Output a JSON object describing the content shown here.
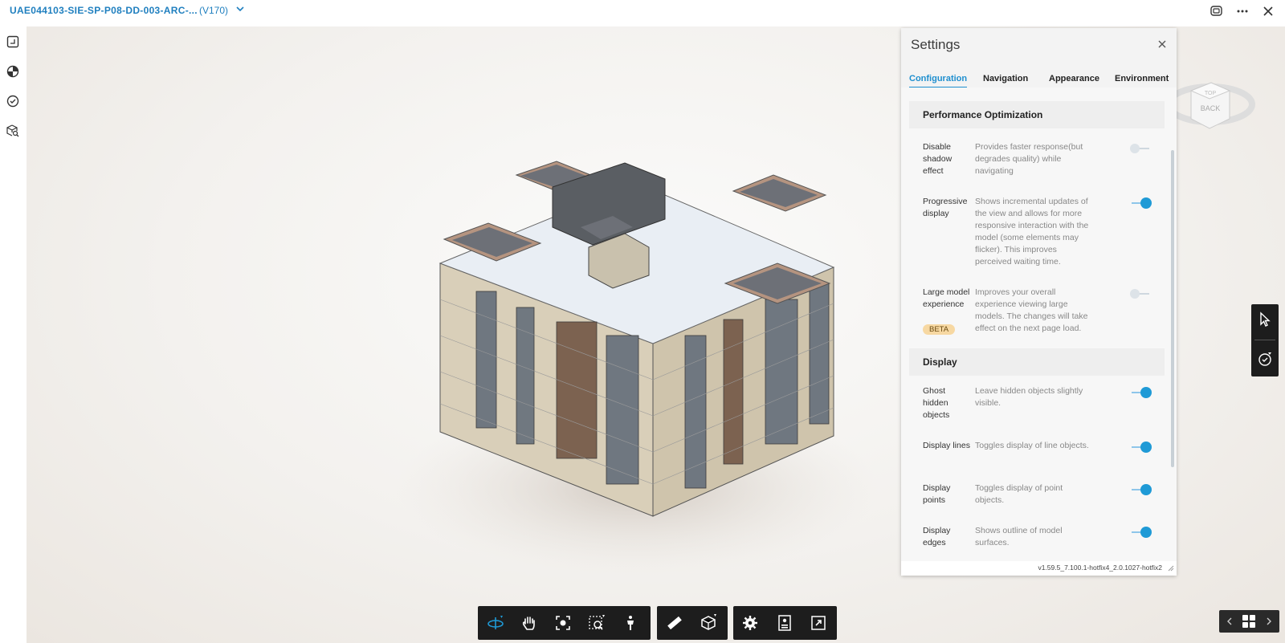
{
  "header": {
    "title": "UAE044103-SIE-SP-P08-DD-003-ARC-...",
    "version": "(V170)"
  },
  "settings": {
    "title": "Settings",
    "tabs": [
      "Configuration",
      "Navigation",
      "Appearance",
      "Environment"
    ],
    "active_tab": "Configuration",
    "sections": [
      {
        "heading": "Performance Optimization",
        "rows": [
          {
            "label": "Disable shadow effect",
            "description": "Provides faster response(but degrades quality) while navigating",
            "enabled": false
          },
          {
            "label": "Progressive display",
            "description": "Shows incremental updates of the view and allows for more responsive interaction with the model (some elements may flicker). This improves perceived waiting time.",
            "enabled": true
          },
          {
            "label": "Large model experience",
            "badge": "BETA",
            "description": "Improves your overall experience viewing large models. The changes will take effect on the next page load.",
            "enabled": false
          }
        ]
      },
      {
        "heading": "Display",
        "rows": [
          {
            "label": "Ghost hidden objects",
            "description": "Leave hidden objects slightly visible.",
            "enabled": true
          },
          {
            "label": "Display lines",
            "description": "Toggles display of line objects.",
            "enabled": true
          },
          {
            "label": "Display points",
            "description": "Toggles display of point objects.",
            "enabled": true
          },
          {
            "label": "Display edges",
            "description": "Shows outline of model surfaces.",
            "enabled": true
          }
        ]
      }
    ],
    "build_version": "v1.59.5_7.100.1-hotfix4_2.0.1027-hotfix2"
  },
  "viewcube": {
    "face_label": "BACK"
  },
  "colors": {
    "accent": "#1f9ad6",
    "toolbar": "#1d1d1d",
    "title_link": "#1f7fbf"
  },
  "toolbar_icons": [
    "orbit-icon",
    "pan-icon",
    "fit-to-view-icon",
    "zoom-window-icon",
    "first-person-icon",
    "measure-icon",
    "section-box-icon",
    "settings-icon",
    "model-browser-icon",
    "fullscreen-icon"
  ]
}
